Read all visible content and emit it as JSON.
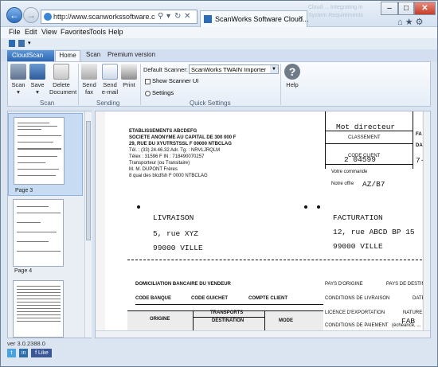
{
  "browser": {
    "url": "http://www.scanworkssoftware.com/products/",
    "tab_title": "ScanWorks Software Cloud...",
    "ghost_text": "Cloud ... Integrating in System Requirements"
  },
  "menu": [
    "File",
    "Edit",
    "View",
    "Favorites",
    "Tools",
    "Help"
  ],
  "ribbon": {
    "app_button": "CloudScan",
    "tabs": [
      "Home",
      "Scan",
      "Premium version"
    ],
    "buttons": {
      "scan": "Scan",
      "save": "Save",
      "delete": "Delete Document",
      "send_fax": "Send fax",
      "send_email": "Send e-mail",
      "print": "Print",
      "help": "Help"
    },
    "groups": [
      "Scan",
      "Sending",
      "Quick Settings"
    ],
    "default_scanner_label": "Default Scanner:",
    "default_scanner_value": "ScanWorks TWAIN Importer",
    "show_scanner_ui": "Show Scanner UI",
    "settings": "Settings"
  },
  "thumbnails": [
    "Page 3",
    "Page 4"
  ],
  "document": {
    "header_lines": [
      "ETABLISSEMENTS ABCDEFG",
      "SOCIETE ANONYME AU CAPITAL DE 300 000 F",
      "29, RUE DU XYUTRSTSSL F 00000 NTBCLAG",
      "Tél. : (33) 24.46.32 Adr. Tg. : NRVLJRQLM",
      "Télex : 31596 F IN : 718490070257",
      "Transporteur (ou Transitaire)",
      "M. M. DUPONT Frères",
      "8 quai des blcdfsh F 0000 NTBCLAG"
    ],
    "mot_directeur": "Mot directeur",
    "classement": "CLASSEMENT",
    "code_client": "CODE CLIENT",
    "code_num": "2 04599",
    "votre_commande": "Votre commande",
    "notre_offre": "Notre offre",
    "offre_val": "AZ/B7",
    "right_fa": "FA",
    "right_da": "DA",
    "right_7": "7-",
    "livraison": "LIVRAISON",
    "liv_addr1": "5, rue XYZ",
    "liv_addr2": "99000 VILLE",
    "facturation": "FACTURATION",
    "fac_addr1": "12, rue ABCD BP 15",
    "fac_addr2": "99000 VILLE",
    "domiciliation": "DOMICILIATION BANCAIRE DU VENDEUR",
    "code_banque": "CODE BANQUE",
    "code_guichet": "CODE GUICHET",
    "compte_client": "COMPTE CLIENT",
    "pays_origine": "PAYS D'ORIGINE",
    "pays_dest": "PAYS DE DESTIN",
    "conditions_liv": "CONDITIONS DE LIVRAISON",
    "date": "DATE",
    "transports": "TRANSPORTS",
    "origine": "ORIGINE",
    "destination": "DESTINATION",
    "mode": "MODE",
    "licence": "LICENCE D'EXPORTATION",
    "nature": "NATURE",
    "fab": "FAB",
    "conditions_paiement": "CONDITIONS DE PAIEMENT",
    "echeance": "(échéance, ..."
  },
  "status": {
    "version": "ver 3.0.2388.0"
  },
  "social": [
    "t",
    "in",
    "f Like"
  ]
}
